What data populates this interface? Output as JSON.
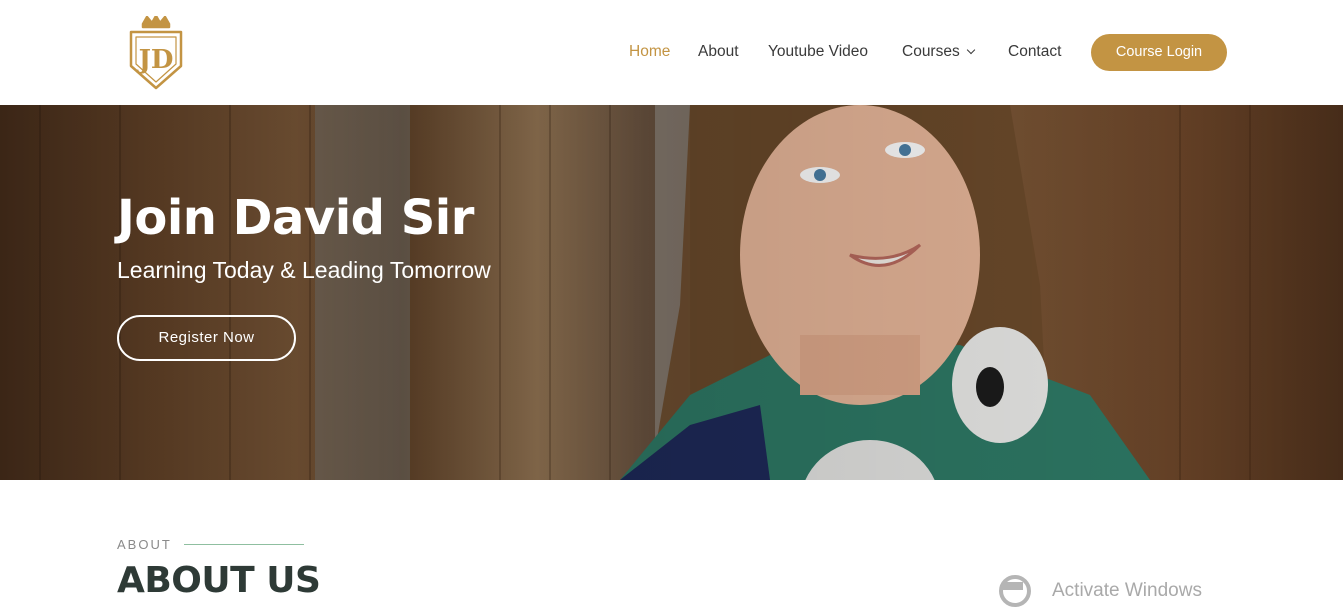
{
  "header": {
    "logo": {
      "text": "JD",
      "icon": "crown-shield-logo"
    },
    "nav": [
      {
        "label": "Home",
        "active": true
      },
      {
        "label": "About",
        "active": false
      },
      {
        "label": "Youtube Video",
        "active": false
      },
      {
        "label": "Courses",
        "active": false,
        "has_dropdown": true
      },
      {
        "label": "Contact",
        "active": false
      }
    ],
    "login_label": "Course Login"
  },
  "hero": {
    "title": "Join David Sir",
    "subtitle": "Learning Today & Leading Tomorrow",
    "cta_label": "Register Now"
  },
  "about": {
    "eyebrow": "ABOUT",
    "title": "ABOUT US"
  },
  "overlay": {
    "watermark": "Activate Windows"
  },
  "colors": {
    "accent": "#c39443",
    "nav_text": "#3a3a3a",
    "heading_dark": "#2e3a36",
    "eyebrow_line": "#8fbfa0"
  }
}
